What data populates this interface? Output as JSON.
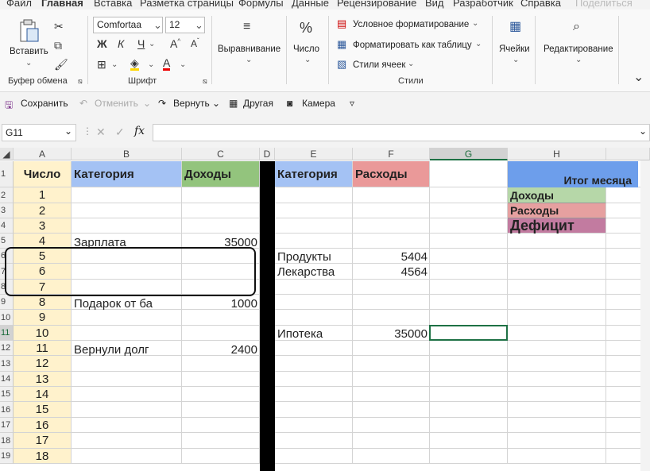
{
  "menu": {
    "tabs": [
      "Файл",
      "Главная",
      "Вставка",
      "Разметка страницы",
      "Формулы",
      "Данные",
      "Рецензирование",
      "Вид",
      "Разработчик",
      "Справка"
    ],
    "active": "Главная",
    "share": "Поделиться"
  },
  "ribbon": {
    "paste": "Вставить",
    "clipboard_group": "Буфер обмена",
    "font_name": "Comfortaa",
    "font_size": "12",
    "bold": "Ж",
    "italic": "К",
    "underline": "Ч",
    "font_group": "Шрифт",
    "align": "Выравнивание",
    "number": "Число",
    "conditional": "Условное форматирование",
    "format_table": "Форматировать как таблицу",
    "cell_styles": "Стили ячеек",
    "styles_group": "Стили",
    "cells": "Ячейки",
    "editing": "Редактирование"
  },
  "qat": {
    "save": "Сохранить",
    "undo": "Отменить",
    "redo": "Вернуть",
    "other": "Другая",
    "camera": "Камера"
  },
  "formula_bar": {
    "name_box": "G11",
    "fx": "fx",
    "value": ""
  },
  "sheet": {
    "columns": [
      "A",
      "B",
      "C",
      "D",
      "E",
      "F",
      "G",
      "H"
    ],
    "selected_column": "G",
    "selected_row": "11",
    "rows": [
      "1",
      "2",
      "3",
      "4",
      "5",
      "6",
      "7",
      "8",
      "9",
      "10",
      "11",
      "12",
      "13",
      "14",
      "15",
      "16",
      "17",
      "18",
      "19"
    ],
    "header": {
      "a": "Число",
      "b": "Категория",
      "c": "Доходы",
      "e": "Категория",
      "f": "Расходы"
    },
    "numbers": [
      "1",
      "2",
      "3",
      "4",
      "5",
      "6",
      "7",
      "8",
      "9",
      "10",
      "11",
      "12",
      "13",
      "14",
      "15",
      "16",
      "17",
      "18"
    ],
    "income": [
      {
        "row": "5",
        "category": "Зарплата",
        "amount": "35000"
      },
      {
        "row": "9",
        "category": "Подарок от ба",
        "amount": "1000"
      },
      {
        "row": "12",
        "category": "Вернули долг",
        "amount": "2400"
      }
    ],
    "expenses": [
      {
        "row": "6",
        "category": "Продукты",
        "amount": "5404"
      },
      {
        "row": "7",
        "category": "Лекарства",
        "amount": "4564"
      },
      {
        "row": "11",
        "category": "Ипотека",
        "amount": "35000"
      }
    ],
    "summary": {
      "title": "Итог месяца",
      "income": "Доходы",
      "expenses": "Расходы",
      "deficit": "Дефицит"
    },
    "colors": {
      "number_fill": "#fff2cc",
      "category_fill": "#a4c2f4",
      "income_fill": "#93c47d",
      "expense_fill": "#ea9999",
      "summary_title_fill": "#6d9eeb",
      "summary_income_fill": "#b6d7a8",
      "summary_expense_fill": "#e6a0a0",
      "summary_deficit_fill": "#c27ba0"
    }
  }
}
